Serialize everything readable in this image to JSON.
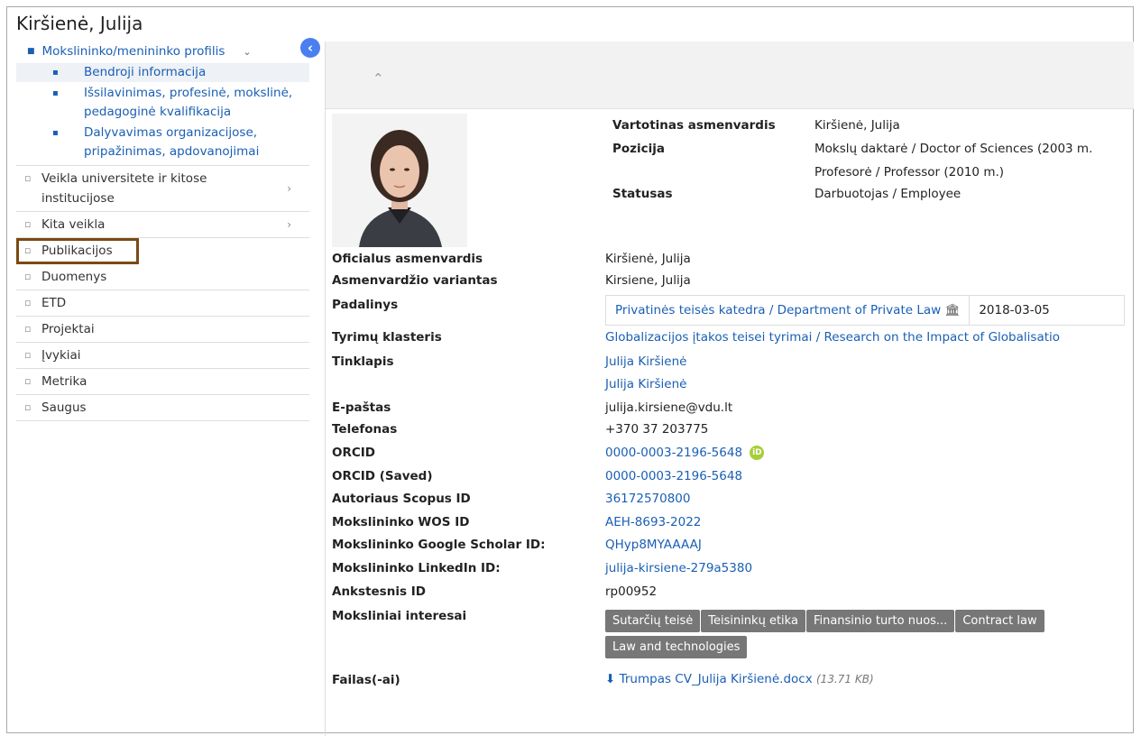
{
  "page_title": "Kiršienė, Julija",
  "sidebar": {
    "top_item": "Mokslininko/menininko profilis",
    "sub_items": [
      "Bendroji informacija",
      "Išsilavinimas, profesinė, mokslinė, pedagoginė kvalifikacija",
      "Dalyvavimas organizacijose, pripažinimas, apdovanojimai"
    ],
    "items": [
      {
        "label": "Veikla universitete ir kitose institucijose"
      },
      {
        "label": "Kita veikla"
      },
      {
        "label": "Publikacijos"
      },
      {
        "label": "Duomenys"
      },
      {
        "label": "ETD"
      },
      {
        "label": "Projektai"
      },
      {
        "label": "Įvykiai"
      },
      {
        "label": "Metrika"
      },
      {
        "label": "Saugus"
      }
    ]
  },
  "header_fields": {
    "name_label": "Vartotinas asmenvardis",
    "name_value": "Kiršienė, Julija",
    "position_label": "Pozicija",
    "position_value_1": "Mokslų daktarė / Doctor of Sciences (2003 m.",
    "position_value_2": "Profesorė / Professor (2010 m.)",
    "status_label": "Statusas",
    "status_value": "Darbuotojas / Employee"
  },
  "fields": {
    "official_name_label": "Oficialus asmenvardis",
    "official_name": "Kiršienė, Julija",
    "variant_label": "Asmenvardžio variantas",
    "variant": "Kirsiene, Julija",
    "dept_label": "Padalinys",
    "dept_name": "Privatinės teisės katedra / Department of Private Law",
    "dept_date": "2018-03-05",
    "cluster_label": "Tyrimų klasteris",
    "cluster": "Globalizacijos įtakos teisei tyrimai / Research on the Impact of Globalisatio",
    "website_label": "Tinklapis",
    "website_1": "Julija Kiršienė",
    "website_2": "Julija Kiršienė",
    "email_label": "E-paštas",
    "email": "julija.kirsiene@vdu.lt",
    "phone_label": "Telefonas",
    "phone": "+370 37 203775",
    "orcid_label": "ORCID",
    "orcid": "0000-0003-2196-5648",
    "orcid_saved_label": "ORCID (Saved)",
    "orcid_saved": "0000-0003-2196-5648",
    "scopus_label": "Autoriaus Scopus ID",
    "scopus": "36172570800",
    "wos_label": "Mokslininko WOS ID",
    "wos": "AEH-8693-2022",
    "scholar_label": "Mokslininko Google Scholar ID:",
    "scholar": "QHyp8MYAAAAJ",
    "linkedin_label": "Mokslininko LinkedIn ID:",
    "linkedin": "julija-kirsiene-279a5380",
    "prev_id_label": "Ankstesnis ID",
    "prev_id": "rp00952",
    "interests_label": "Moksliniai interesai",
    "interests": [
      "Sutarčių teisė",
      "Teisininkų etika",
      "Finansinio turto nuos...",
      "Contract law",
      "Law and technologies"
    ],
    "files_label": "Failas(-ai)",
    "file_name": "Trumpas CV_Julija Kiršienė.docx",
    "file_size": "(13.71 KB)"
  }
}
